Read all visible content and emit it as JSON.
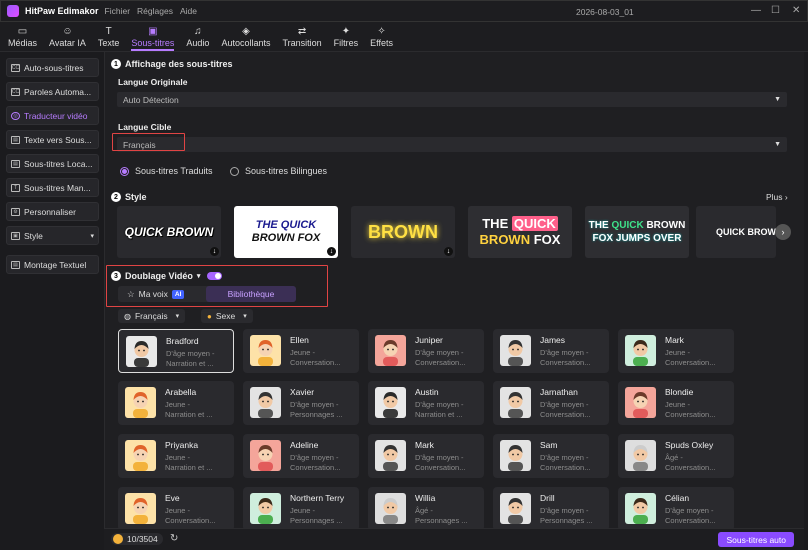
{
  "app": {
    "name": "HitPaw Edimakor",
    "menu": [
      "Fichier",
      "Réglages",
      "Aide"
    ],
    "document": "2026-08-03_01"
  },
  "toolbar": [
    {
      "label": "Médias",
      "icon": "media-icon",
      "glyph": "▭"
    },
    {
      "label": "Avatar IA",
      "icon": "avatar-ai-icon",
      "glyph": "☺"
    },
    {
      "label": "Texte",
      "icon": "text-icon",
      "glyph": "T"
    },
    {
      "label": "Sous-titres",
      "icon": "subtitles-icon",
      "glyph": "▣",
      "active": true
    },
    {
      "label": "Audio",
      "icon": "audio-icon",
      "glyph": "♫"
    },
    {
      "label": "Autocollants",
      "icon": "stickers-icon",
      "glyph": "◈"
    },
    {
      "label": "Transition",
      "icon": "transition-icon",
      "glyph": "⇄"
    },
    {
      "label": "Filtres",
      "icon": "filters-icon",
      "glyph": "✦"
    },
    {
      "label": "Effets",
      "icon": "effects-icon",
      "glyph": "✧"
    }
  ],
  "sidebar": [
    {
      "label": "Auto-sous-titres",
      "icon": "cc-icon",
      "glyph": "CC"
    },
    {
      "label": "Paroles Automa...",
      "icon": "lyrics-icon",
      "glyph": "CC"
    },
    {
      "label": "Traducteur vidéo",
      "icon": "translate-icon",
      "glyph": "◎",
      "active": true
    },
    {
      "label": "Texte vers Sous...",
      "icon": "text-to-subtitle-icon",
      "glyph": "▤"
    },
    {
      "label": "Sous-titres Loca...",
      "icon": "local-subtitles-icon",
      "glyph": "▤"
    },
    {
      "label": "Sous-titres Man...",
      "icon": "manual-subtitles-icon",
      "glyph": "T"
    },
    {
      "label": "Personnaliser",
      "icon": "customize-icon",
      "glyph": "⚙"
    },
    {
      "label": "Style",
      "icon": "style-icon",
      "glyph": "▣",
      "caret": "▾"
    },
    {
      "label": "Montage Textuel",
      "icon": "text-edit-icon",
      "glyph": "▤",
      "gap": true
    }
  ],
  "section1": {
    "num": "1",
    "title": "Affichage des sous-titres",
    "source_label": "Langue Originale",
    "source_value": "Auto Détection",
    "target_label": "Langue Cible",
    "target_value": "Français",
    "radio_translated": "Sous-titres Traduits",
    "radio_bilingual": "Sous-titres Bilingues"
  },
  "section2": {
    "num": "2",
    "title": "Style",
    "more": "Plus",
    "presets": [
      {
        "text": "QUICK BROWN"
      },
      {
        "line1": "THE QUICK",
        "line2": "BROWN FOX"
      },
      {
        "text": "BROWN"
      },
      {
        "line1a": "THE ",
        "line1b": "QUICK",
        "line2a": "BROWN ",
        "line2b": "FOX"
      },
      {
        "line1a": "THE ",
        "line1b": "QUICK",
        "line1c": " BROWN",
        "line2": "FOX JUMPS OVER"
      },
      {
        "text": "QUICK BROW"
      }
    ]
  },
  "section3": {
    "num": "3",
    "title": "Doublage Vidéo",
    "my_voice": "Ma voix",
    "ai_badge": "AI",
    "library": "Bibliothèque",
    "filter_language": "Français",
    "filter_gender": "Sexe"
  },
  "voices": [
    {
      "name": "Bradford",
      "line1": "D'âge moyen -",
      "line2": "Narration et ...",
      "selected": true,
      "avatar": "man-dark"
    },
    {
      "name": "Ellen",
      "line1": "Jeune -",
      "line2": "Conversation...",
      "avatar": "girl-orange"
    },
    {
      "name": "Juniper",
      "line1": "D'âge moyen -",
      "line2": "Conversation...",
      "avatar": "woman-red"
    },
    {
      "name": "James",
      "line1": "D'âge moyen -",
      "line2": "Conversation...",
      "avatar": "man-glasses"
    },
    {
      "name": "Mark",
      "line1": "Jeune -",
      "line2": "Conversation...",
      "avatar": "boy-green"
    },
    {
      "name": "Arabella",
      "line1": "Jeune -",
      "line2": "Narration et ...",
      "avatar": "girl-orange"
    },
    {
      "name": "Xavier",
      "line1": "D'âge moyen -",
      "line2": "Personnages ...",
      "avatar": "man-glasses"
    },
    {
      "name": "Austin",
      "line1": "D'âge moyen -",
      "line2": "Narration et ...",
      "avatar": "man-dark"
    },
    {
      "name": "Jarnathan",
      "line1": "D'âge moyen -",
      "line2": "Conversation...",
      "avatar": "man-glasses"
    },
    {
      "name": "Blondie",
      "line1": "Jeune -",
      "line2": "Conversation...",
      "avatar": "woman-red"
    },
    {
      "name": "Priyanka",
      "line1": "Jeune -",
      "line2": "Narration et ...",
      "avatar": "girl-orange"
    },
    {
      "name": "Adeline",
      "line1": "D'âge moyen -",
      "line2": "Conversation...",
      "avatar": "woman-red"
    },
    {
      "name": "Mark",
      "line1": "D'âge moyen -",
      "line2": "Conversation...",
      "avatar": "man-glasses"
    },
    {
      "name": "Sam",
      "line1": "D'âge moyen -",
      "line2": "Conversation...",
      "avatar": "man-glasses"
    },
    {
      "name": "Spuds Oxley",
      "line1": "Âgé -",
      "line2": "Conversation...",
      "avatar": "old-man"
    },
    {
      "name": "Eve",
      "line1": "Jeune -",
      "line2": "Conversation...",
      "avatar": "girl-orange"
    },
    {
      "name": "Northern Terry",
      "line1": "Jeune -",
      "line2": "Personnages ...",
      "avatar": "boy-green"
    },
    {
      "name": "Willia",
      "line1": "Âgé -",
      "line2": "Personnages ...",
      "avatar": "old-man"
    },
    {
      "name": "Drill",
      "line1": "D'âge moyen -",
      "line2": "Personnages ...",
      "avatar": "man-glasses"
    },
    {
      "name": "Célian",
      "line1": "D'âge moyen -",
      "line2": "Conversation...",
      "avatar": "boy-green"
    }
  ],
  "footer": {
    "credits": "10/3504",
    "auto_button": "Sous-titres auto"
  },
  "colors": {
    "accent": "#b77cff",
    "button": "#8a4bff",
    "highlight_box": "#e04444",
    "ai_badge": "#4263ff"
  }
}
